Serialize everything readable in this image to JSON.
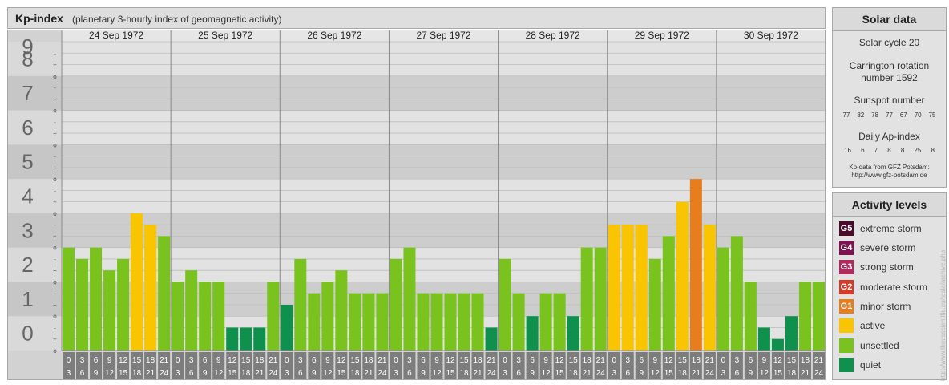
{
  "header": {
    "title": "Kp-index",
    "subtitle": "(planetary 3-hourly index of geomagnetic activity)"
  },
  "chart_data": {
    "type": "bar",
    "ylim": [
      0,
      9
    ],
    "y_ticks": [
      "0",
      "1",
      "2",
      "3",
      "4",
      "5",
      "6",
      "7",
      "8",
      "9"
    ],
    "minor_marks": [
      "o",
      "+",
      "-"
    ],
    "days": [
      "24 Sep 1972",
      "25 Sep 1972",
      "26 Sep 1972",
      "27 Sep 1972",
      "28 Sep 1972",
      "29 Sep 1972",
      "30 Sep 1972"
    ],
    "interval_labels": [
      [
        "0",
        "3"
      ],
      [
        "3",
        "6"
      ],
      [
        "6",
        "9"
      ],
      [
        "9",
        "12"
      ],
      [
        "12",
        "15"
      ],
      [
        "15",
        "18"
      ],
      [
        "18",
        "21"
      ],
      [
        "21",
        "24"
      ]
    ],
    "values": [
      [
        3.0,
        2.667,
        3.0,
        2.333,
        2.667,
        4.0,
        3.667,
        3.333
      ],
      [
        2.0,
        2.333,
        2.0,
        2.0,
        0.667,
        0.667,
        0.667,
        2.0
      ],
      [
        1.333,
        2.667,
        1.667,
        2.0,
        2.333,
        1.667,
        1.667,
        1.667
      ],
      [
        2.667,
        3.0,
        1.667,
        1.667,
        1.667,
        1.667,
        1.667,
        0.667
      ],
      [
        2.667,
        1.667,
        1.0,
        1.667,
        1.667,
        1.0,
        3.0,
        3.0
      ],
      [
        3.667,
        3.667,
        3.667,
        2.667,
        3.333,
        4.333,
        5.0,
        3.667
      ],
      [
        3.0,
        3.333,
        2.0,
        0.667,
        0.333,
        1.0,
        2.0,
        2.0
      ]
    ],
    "colors": {
      "quiet": "#10904d",
      "unsettled": "#7ac31f",
      "active": "#f9c400",
      "minor_storm": "#e87d1e",
      "moderate_storm": "#d53a27",
      "strong_storm": "#b3285d",
      "severe_storm": "#7d1451",
      "extreme_storm": "#4a0a2c"
    }
  },
  "solar": {
    "title": "Solar data",
    "cycle": "Solar cycle 20",
    "carrington_line1": "Carrington rotation",
    "carrington_line2": "number 1592",
    "sunspot_label": "Sunspot number",
    "sunspot_values": [
      "77",
      "82",
      "78",
      "77",
      "67",
      "70",
      "75"
    ],
    "ap_label": "Daily Ap-index",
    "ap_values": [
      "16",
      "6",
      "7",
      "8",
      "8",
      "25",
      "8"
    ],
    "source_line1": "Kp-data from GFZ Potsdam:",
    "source_line2": "http://www.gfz-potsdam.de"
  },
  "activity": {
    "title": "Activity levels",
    "items": [
      {
        "code": "G5",
        "label": "extreme storm",
        "color": "#4a0a2c"
      },
      {
        "code": "G4",
        "label": "severe storm",
        "color": "#7d1451"
      },
      {
        "code": "G3",
        "label": "strong storm",
        "color": "#b3285d"
      },
      {
        "code": "G2",
        "label": "moderate storm",
        "color": "#d53a27"
      },
      {
        "code": "G1",
        "label": "minor storm",
        "color": "#e87d1e"
      },
      {
        "code": "",
        "label": "active",
        "color": "#f9c400"
      },
      {
        "code": "",
        "label": "unsettled",
        "color": "#7ac31f"
      },
      {
        "code": "",
        "label": "quiet",
        "color": "#10904d"
      }
    ]
  },
  "credit": "http://www.theusscientific.eu/tesla/archive.php"
}
